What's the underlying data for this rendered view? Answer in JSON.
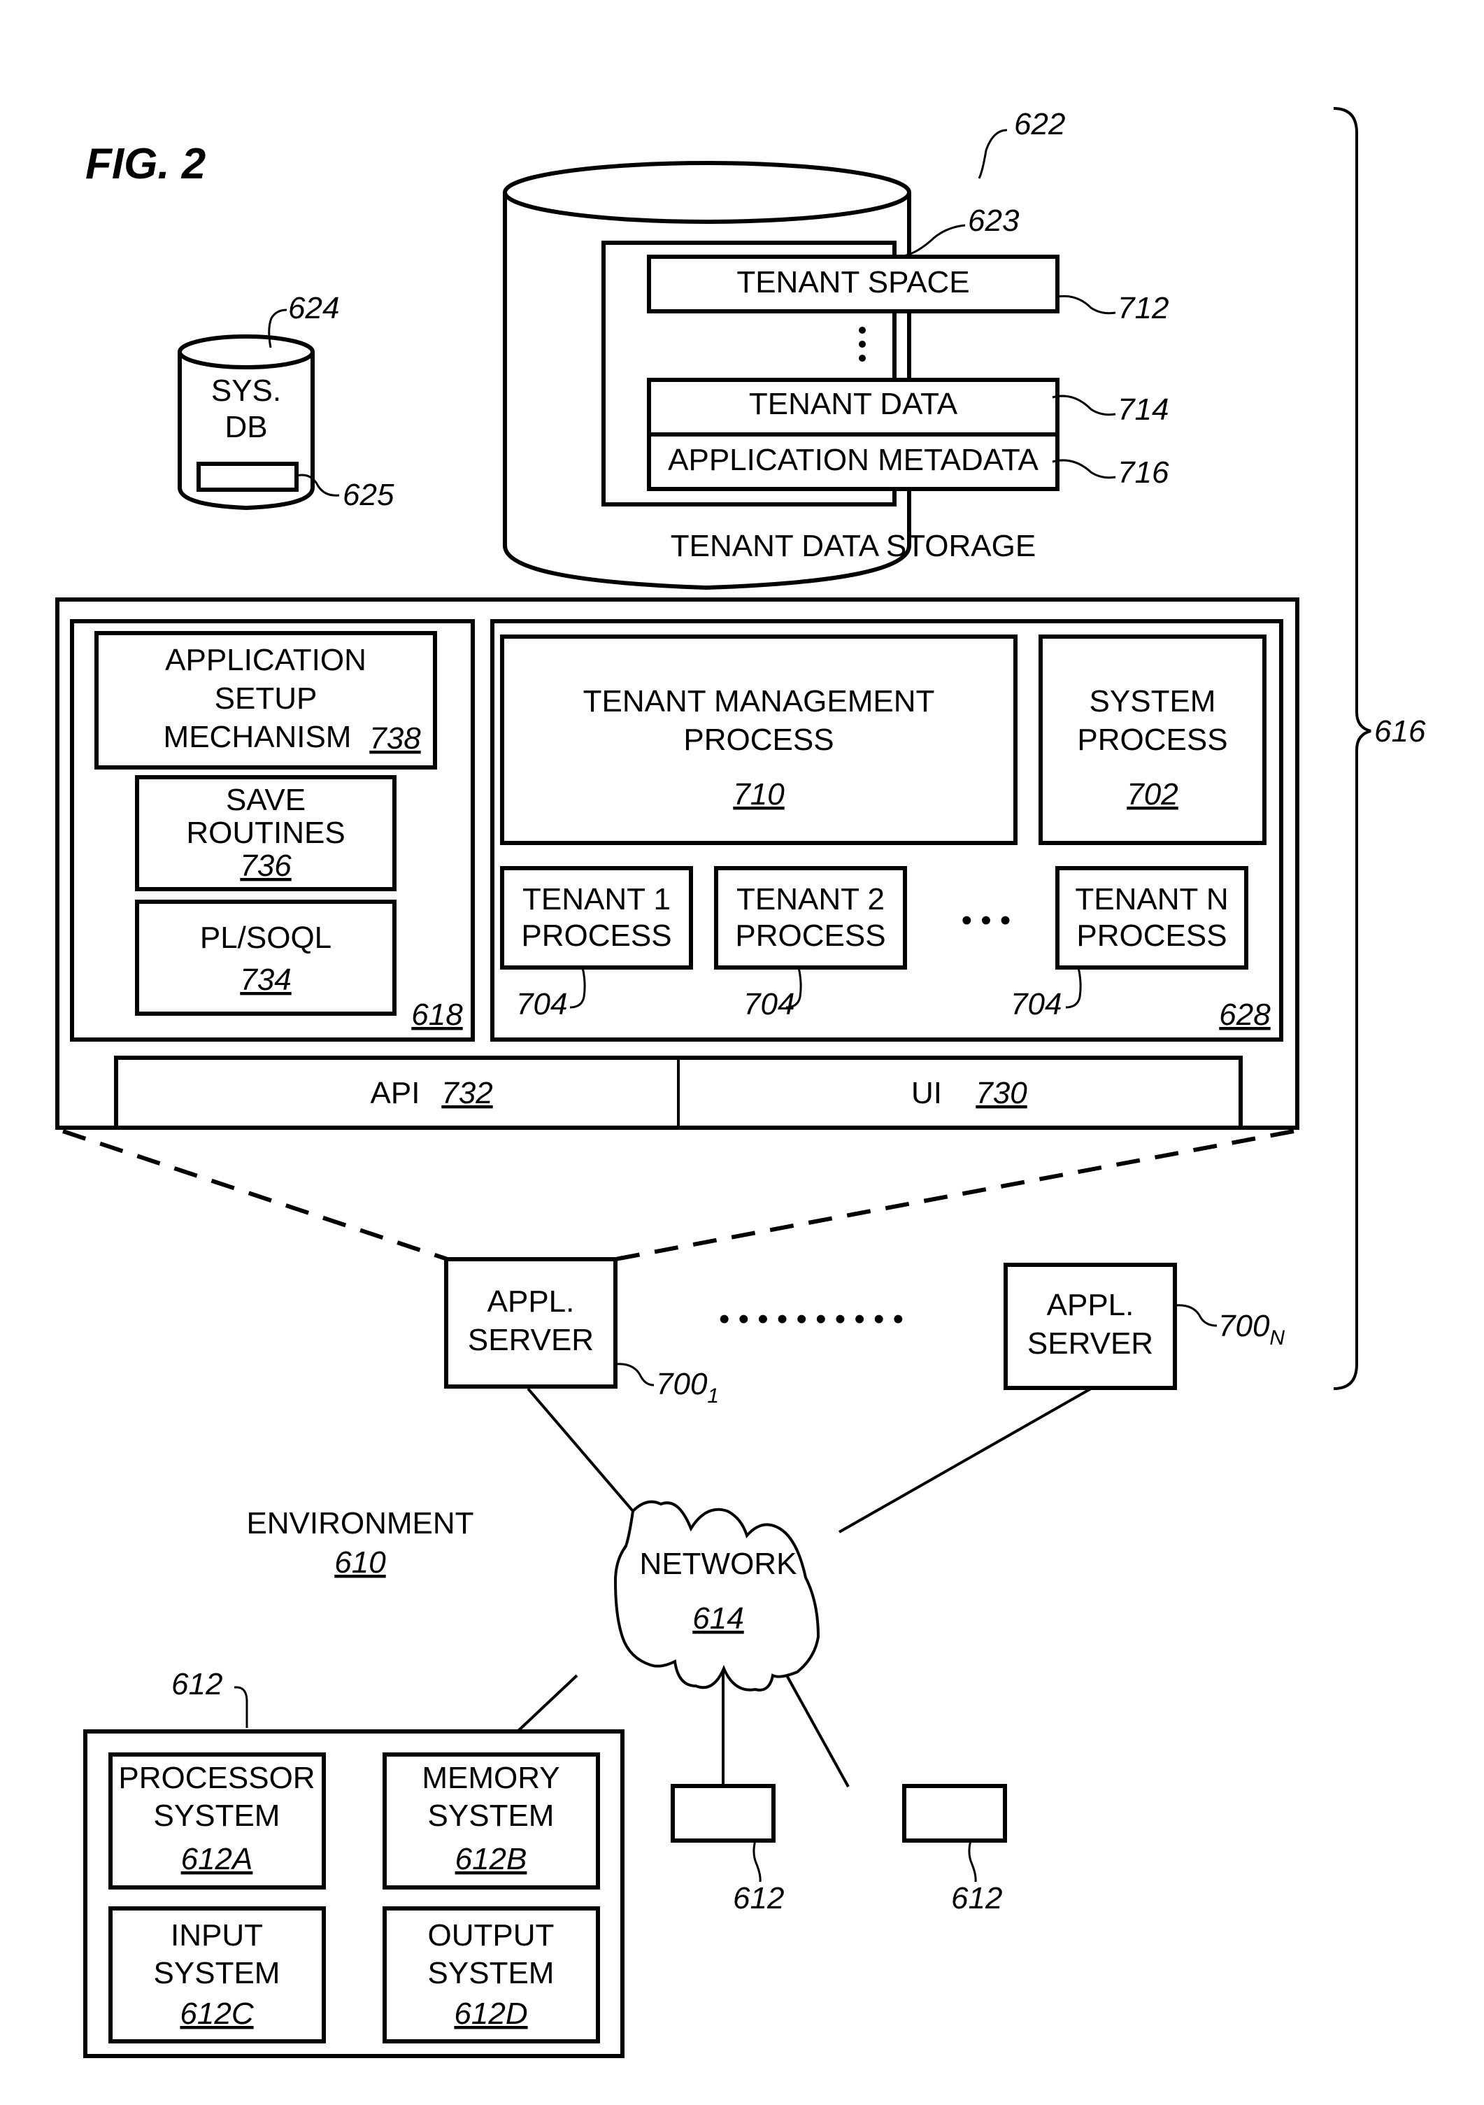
{
  "figure": {
    "title": "FIG. 2"
  },
  "tenant_storage": {
    "label": "TENANT DATA STORAGE",
    "ref": "622",
    "inner_ref": "623",
    "tenant_space": {
      "label": "TENANT SPACE",
      "ref": "712"
    },
    "tenant_data": {
      "label": "TENANT DATA",
      "ref": "714"
    },
    "app_metadata": {
      "label": "APPLICATION METADATA",
      "ref": "716"
    }
  },
  "sys_db": {
    "line1": "SYS.",
    "line2": "DB",
    "ref": "624",
    "inner_ref": "625"
  },
  "system_brace": {
    "ref": "616"
  },
  "left_panel": {
    "ref": "618",
    "app_setup": {
      "line1": "APPLICATION",
      "line2": "SETUP",
      "line3": "MECHANISM",
      "ref": "738"
    },
    "save_routines": {
      "line1": "SAVE",
      "line2": "ROUTINES",
      "ref": "736"
    },
    "plsoql": {
      "line1": "PL/SOQL",
      "ref": "734"
    }
  },
  "right_panel": {
    "ref": "628",
    "tenant_mgmt": {
      "line1": "TENANT MANAGEMENT",
      "line2": "PROCESS",
      "ref": "710"
    },
    "system_process": {
      "line1": "SYSTEM",
      "line2": "PROCESS",
      "ref": "702"
    },
    "tenant_processes": [
      {
        "line1": "TENANT 1",
        "line2": "PROCESS",
        "ref": "704"
      },
      {
        "line1": "TENANT 2",
        "line2": "PROCESS",
        "ref": "704"
      },
      {
        "line1": "TENANT N",
        "line2": "PROCESS",
        "ref": "704"
      }
    ],
    "ellipsis": "• • •"
  },
  "interfaces": {
    "api": {
      "label": "API",
      "ref": "732"
    },
    "ui": {
      "label": "UI",
      "ref": "730"
    }
  },
  "app_servers": [
    {
      "line1": "APPL.",
      "line2": "SERVER",
      "ref": "700",
      "sub": "1"
    },
    {
      "line1": "APPL.",
      "line2": "SERVER",
      "ref": "700",
      "sub": "N"
    }
  ],
  "server_ellipsis": "• • • • • • • • • •",
  "environment": {
    "label": "ENVIRONMENT",
    "ref": "610"
  },
  "network": {
    "label": "NETWORK",
    "ref": "614"
  },
  "user_system": {
    "ref": "612",
    "components": [
      {
        "line1": "PROCESSOR",
        "line2": "SYSTEM",
        "ref": "612A"
      },
      {
        "line1": "MEMORY",
        "line2": "SYSTEM",
        "ref": "612B"
      },
      {
        "line1": "INPUT",
        "line2": "SYSTEM",
        "ref": "612C"
      },
      {
        "line1": "OUTPUT",
        "line2": "SYSTEM",
        "ref": "612D"
      }
    ]
  },
  "other_user_systems": [
    {
      "ref": "612"
    },
    {
      "ref": "612"
    }
  ]
}
